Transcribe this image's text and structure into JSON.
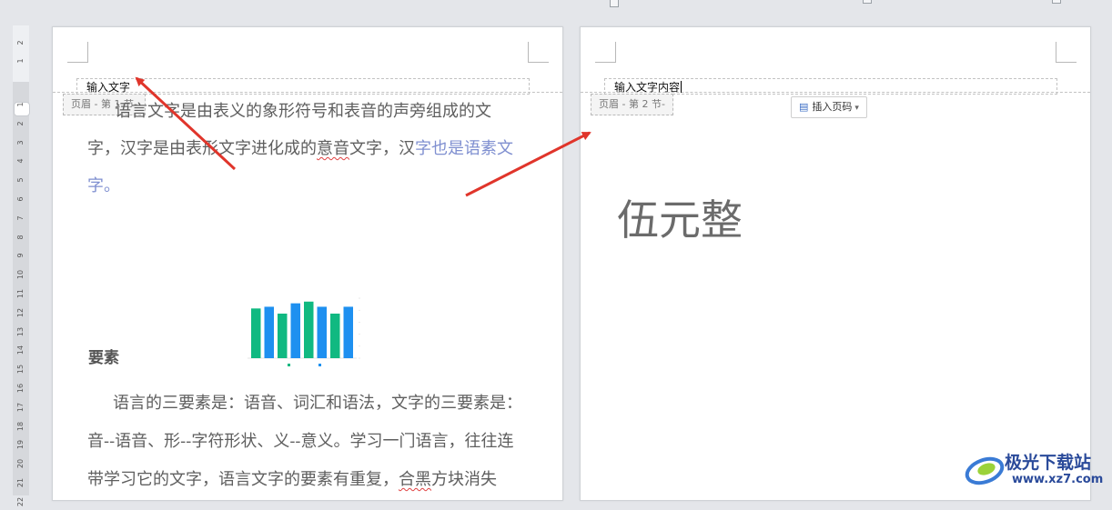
{
  "ruler": {
    "ticks": [
      "2",
      "1",
      "1",
      "2",
      "3",
      "4",
      "5",
      "6",
      "7",
      "8",
      "9",
      "10",
      "11",
      "12",
      "13",
      "14",
      "15",
      "16",
      "17",
      "18",
      "19",
      "20",
      "21",
      "22"
    ]
  },
  "page1": {
    "header_text": "输入文字",
    "section_label": "页眉  - 第 1 节-",
    "para1_line1": "语言文字是由表义的象形符号和表音的声旁组成的文",
    "para1_line2_a": "字，汉字是由表形文字进化成的",
    "para1_line2_squig": "意音",
    "para1_line2_b": "文字，汉",
    "para1_line2_blue": "字也是语素文",
    "para1_line3_blue": "字。",
    "heading": "要素",
    "para2_line1": "语言的三要素是：语音、词汇和语法，文字的三要素是：",
    "para2_line2": "音--语音、形--字符形状、义--意义。学习一门语言，往往连",
    "para2_line3_a": "带学习它的文字，语言文字的要素有重复，",
    "para2_line3_squig": "合黑",
    "para2_line3_b": "方块消失"
  },
  "page2": {
    "header_text": "输入文字内容",
    "section_label": "页眉  - 第 2 节-",
    "insert_page_number": "插入页码",
    "body_text": "伍元整"
  },
  "chart_data": {
    "type": "bar",
    "categories": [
      "",
      "",
      "",
      "",
      "",
      "",
      "",
      ""
    ],
    "series": [
      {
        "values": [
          58,
          60,
          52,
          64,
          66,
          60,
          52,
          60
        ]
      }
    ],
    "colors": [
      "#10b981",
      "#1e90f0",
      "#10b981",
      "#1e90f0",
      "#10b981",
      "#1e90f0",
      "#10b981",
      "#1e90f0"
    ],
    "ylim": [
      0,
      70
    ],
    "legend": "bottom"
  },
  "watermark": {
    "title": "极光下载站",
    "url": "www.xz7.com"
  },
  "colors": {
    "arrow": "#e0352b",
    "accent": "#3b6cc4",
    "background": "#e4e6ea"
  }
}
